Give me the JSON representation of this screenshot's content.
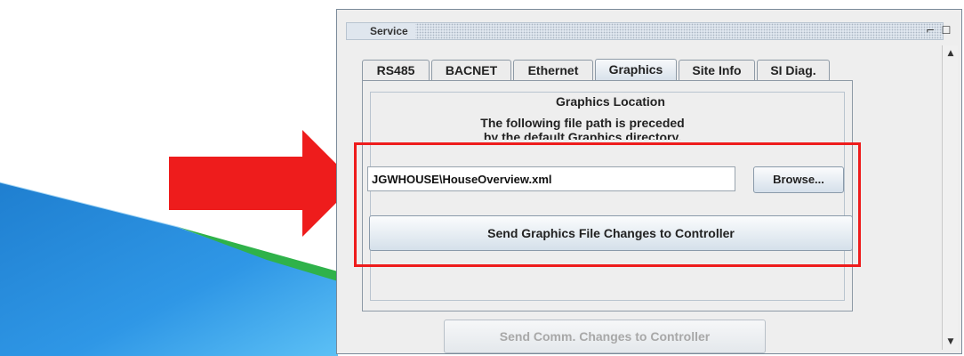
{
  "window": {
    "title": "Service",
    "minimize_glyph": "⌐",
    "maximize_glyph": "☐"
  },
  "tabs": [
    {
      "label": "RS485",
      "active": false
    },
    {
      "label": "BACNET",
      "active": false
    },
    {
      "label": "Ethernet",
      "active": false
    },
    {
      "label": "Graphics",
      "active": true
    },
    {
      "label": "Site Info",
      "active": false
    },
    {
      "label": "SI Diag.",
      "active": false
    }
  ],
  "graphics": {
    "group_title": "Graphics Location",
    "description_line1": "The following file path is preceded",
    "description_line2": "by the default Graphics directory.",
    "file_path": "JGWHOUSE\\HouseOverview.xml",
    "browse_label": "Browse...",
    "send_graphics_label": "Send Graphics File Changes to Controller"
  },
  "footer": {
    "send_comm_label": "Send Comm. Changes to Controller",
    "send_comm_enabled": false
  },
  "colors": {
    "highlight": "#ee1c1c",
    "arrow": "#ee1c1c"
  },
  "icons": {
    "scroll_up": "▲",
    "scroll_down": "▼"
  }
}
